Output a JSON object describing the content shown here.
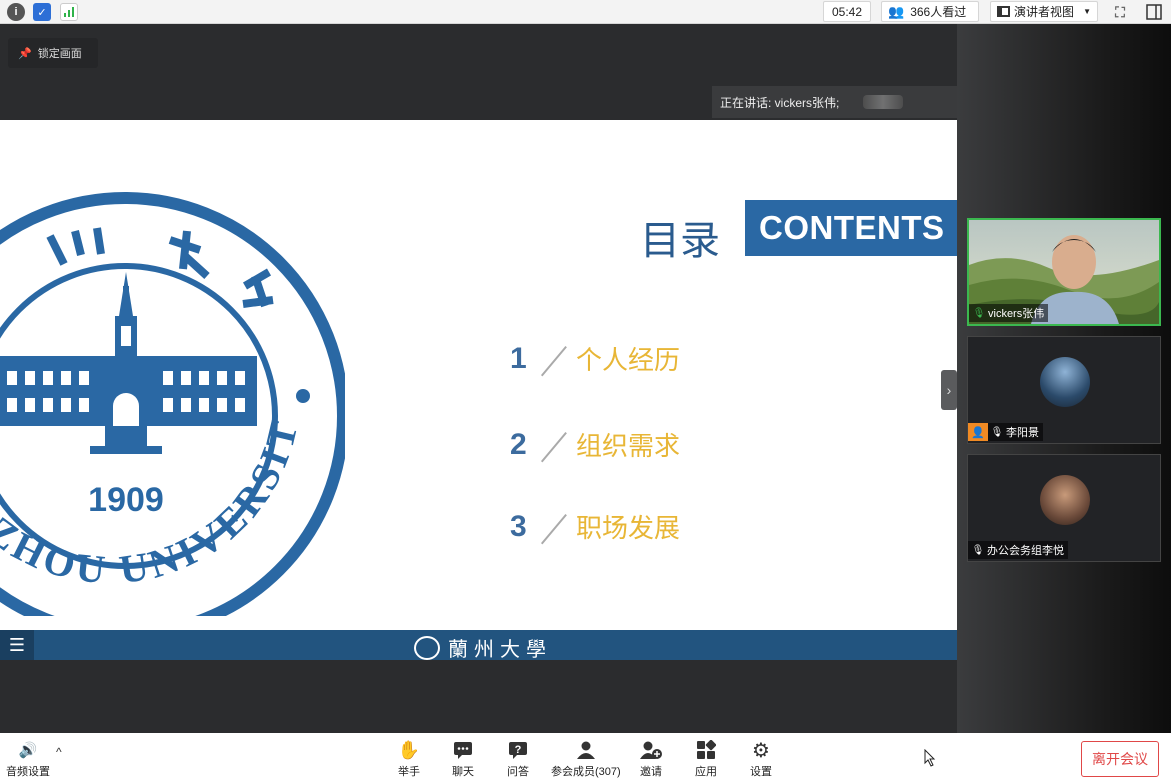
{
  "topbar": {
    "timer": "05:42",
    "viewers": "366人看过",
    "view_mode": "演讲者视图",
    "icons": [
      "info-icon",
      "shield-icon",
      "signal-icon",
      "fullscreen-icon",
      "sidebar-toggle-icon"
    ]
  },
  "stage": {
    "lock_label": "锁定画面",
    "speaking_label": "正在讲话: vickers张伟;"
  },
  "slide": {
    "title_cn": "目录",
    "title_en": "CONTENTS",
    "seal_year": "1909",
    "seal_text": "ZHOU UNIVERSITY",
    "toc": [
      {
        "num": "1",
        "label": "个人经历"
      },
      {
        "num": "2",
        "label": "组织需求"
      },
      {
        "num": "3",
        "label": "职场发展"
      }
    ],
    "footer_text": "蘭州大學",
    "colors": {
      "primary": "#2a68a4",
      "accent": "#e8b636"
    }
  },
  "participants": [
    {
      "name": "vickers张伟",
      "active": true
    },
    {
      "name": "李阳景",
      "active": false
    },
    {
      "name": "办公会务组李悦",
      "active": false
    }
  ],
  "toolbar": {
    "audio": "音频设置",
    "items": [
      {
        "label": "举手",
        "icon": "raise-hand-icon"
      },
      {
        "label": "聊天",
        "icon": "chat-icon"
      },
      {
        "label": "问答",
        "icon": "qa-icon"
      },
      {
        "label": "参会成员(307)",
        "icon": "members-icon"
      },
      {
        "label": "邀请",
        "icon": "invite-icon"
      },
      {
        "label": "应用",
        "icon": "apps-icon"
      },
      {
        "label": "设置",
        "icon": "settings-icon"
      }
    ],
    "leave": "离开会议"
  }
}
